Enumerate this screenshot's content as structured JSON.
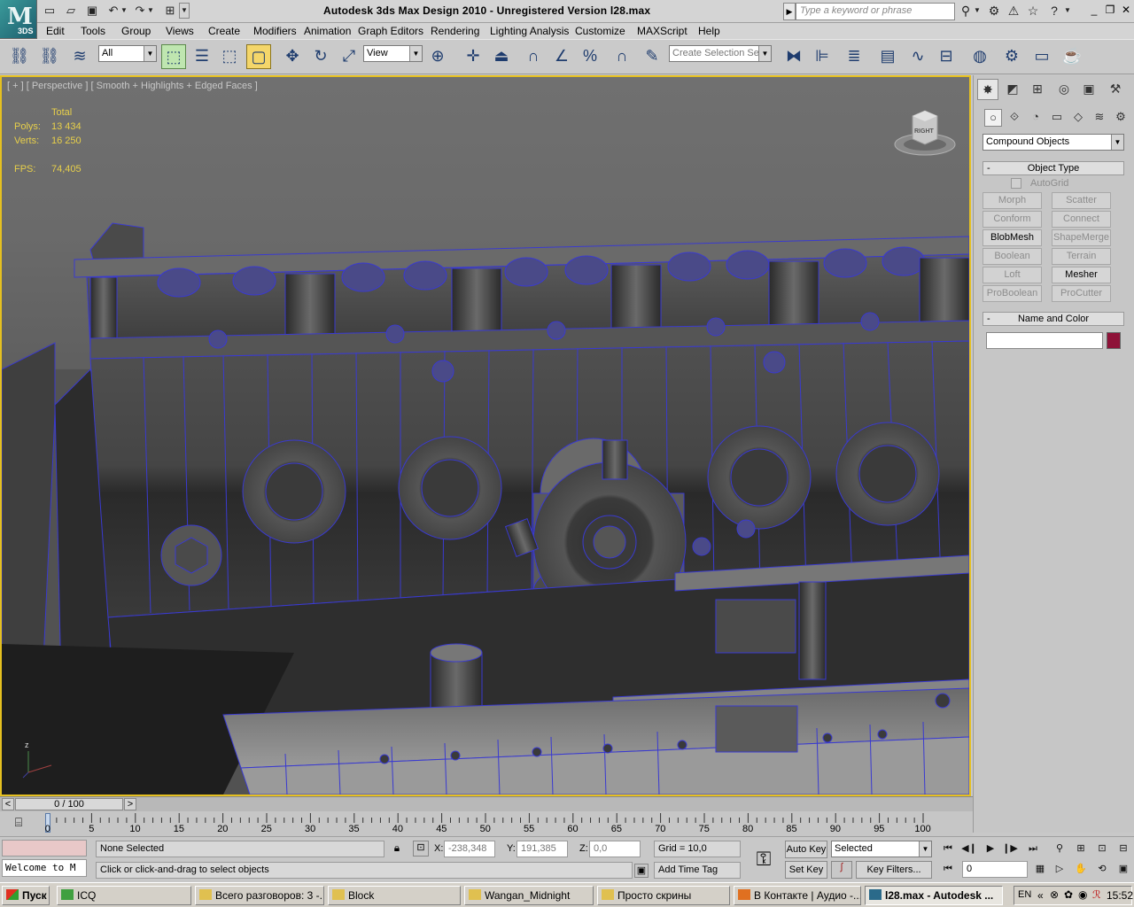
{
  "window": {
    "title": "Autodesk 3ds Max Design 2010  -  Unregistered Version      l28.max",
    "search_placeholder": "Type a keyword or phrase",
    "logo_letter": "M",
    "logo_sub": "3DS"
  },
  "menu": [
    "Edit",
    "Tools",
    "Group",
    "Views",
    "Create",
    "Modifiers",
    "Animation",
    "Graph Editors",
    "Rendering",
    "Lighting Analysis",
    "Customize",
    "MAXScript",
    "Help"
  ],
  "toolbar": {
    "selection_filter": "All",
    "ref_coord": "View",
    "named_selection_placeholder": "Create Selection Se"
  },
  "viewport": {
    "label": "[ + ] [ Perspective ] [ Smooth + Highlights + Edged Faces ]",
    "stats": {
      "header": "Total",
      "polys_label": "Polys:",
      "polys_value": "13 434",
      "verts_label": "Verts:",
      "verts_value": "16 250",
      "fps_label": "FPS:",
      "fps_value": "74,405"
    },
    "viewcube_label": "RIGHT",
    "axis_z": "z"
  },
  "command_panel": {
    "category": "Compound Objects",
    "object_type_title": "Object Type",
    "autogrid_label": "AutoGrid",
    "buttons": [
      {
        "label": "Morph",
        "enabled": false
      },
      {
        "label": "Scatter",
        "enabled": false
      },
      {
        "label": "Conform",
        "enabled": false
      },
      {
        "label": "Connect",
        "enabled": false
      },
      {
        "label": "BlobMesh",
        "enabled": true
      },
      {
        "label": "ShapeMerge",
        "enabled": false
      },
      {
        "label": "Boolean",
        "enabled": false
      },
      {
        "label": "Terrain",
        "enabled": false
      },
      {
        "label": "Loft",
        "enabled": false
      },
      {
        "label": "Mesher",
        "enabled": true
      },
      {
        "label": "ProBoolean",
        "enabled": false
      },
      {
        "label": "ProCutter",
        "enabled": false
      }
    ],
    "name_color_title": "Name and Color",
    "object_name": "",
    "object_color": "#8e1238"
  },
  "timeslider": {
    "label": "0 / 100",
    "prev": "<",
    "next": ">"
  },
  "trackbar": {
    "ticks": [
      "0",
      "5",
      "10",
      "15",
      "20",
      "25",
      "30",
      "35",
      "40",
      "45",
      "50",
      "55",
      "60",
      "65",
      "70",
      "75",
      "80",
      "85",
      "90",
      "95",
      "100"
    ]
  },
  "status": {
    "maxscript_listener": "Welcome to M",
    "selection": "None Selected",
    "prompt": "Click or click-and-drag to select objects",
    "x_label": "X:",
    "x_value": "-238,348",
    "y_label": "Y:",
    "y_value": "191,385",
    "z_label": "Z:",
    "z_value": "0,0",
    "grid": "Grid = 10,0",
    "add_time_tag": "Add Time Tag",
    "auto_key": "Auto Key",
    "set_key": "Set Key",
    "key_mode": "Selected",
    "key_filters": "Key Filters...",
    "current_frame": "0"
  },
  "taskbar": {
    "start": "Пуск",
    "tasks": [
      {
        "label": "ICQ",
        "active": false
      },
      {
        "label": "Всего разговоров: 3 -...",
        "active": false
      },
      {
        "label": "Block",
        "active": false
      },
      {
        "label": "Wangan_Midnight",
        "active": false
      },
      {
        "label": "Просто скрины",
        "active": false
      },
      {
        "label": "В Контакте | Аудио -...",
        "active": false
      },
      {
        "label": "l28.max - Autodesk ...",
        "active": true
      }
    ],
    "lang": "EN",
    "clock": "15:52"
  },
  "colors": {
    "viewport_border": "#e5c020",
    "wire": "#3a3ad0",
    "stats_text": "#e8d04a"
  }
}
